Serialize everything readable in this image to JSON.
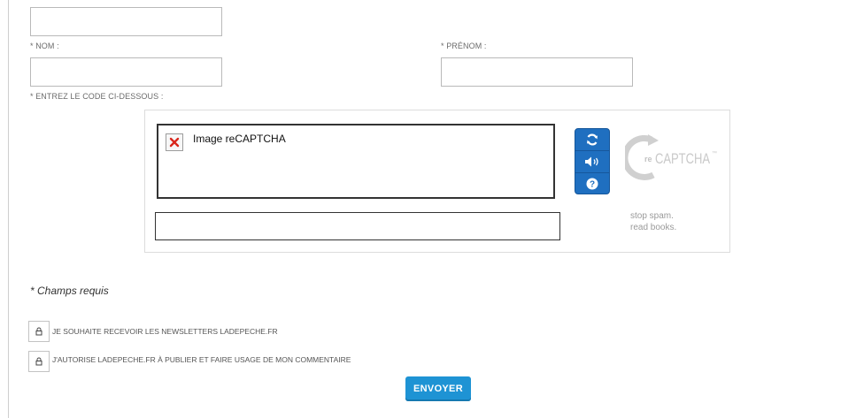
{
  "form": {
    "nom_label": "* NOM :",
    "prenom_label": "* PRÉNOM :",
    "captcha_label": "* ENTREZ LE CODE CI-DESSOUS :",
    "required_note": "* Champs requis",
    "submit_label": "ENVOYER"
  },
  "recaptcha": {
    "image_alt": "Image reCAPTCHA",
    "logo_text": "reCAPTCHA",
    "tagline_1": "stop spam.",
    "tagline_2": "read books.",
    "icons": [
      "refresh-icon",
      "audio-icon",
      "help-icon"
    ],
    "accent_color": "#1f6fc0"
  },
  "checkboxes": [
    {
      "label": "JE SOUHAITE RECEVOIR LES NEWSLETTERS LADEPECHE.FR"
    },
    {
      "label": "J'AUTORISE LADEPECHE.FR À PUBLIER ET FAIRE USAGE DE MON COMMENTAIRE"
    }
  ],
  "colors": {
    "button": "#1e93d4",
    "border": "#b9b9b9"
  }
}
